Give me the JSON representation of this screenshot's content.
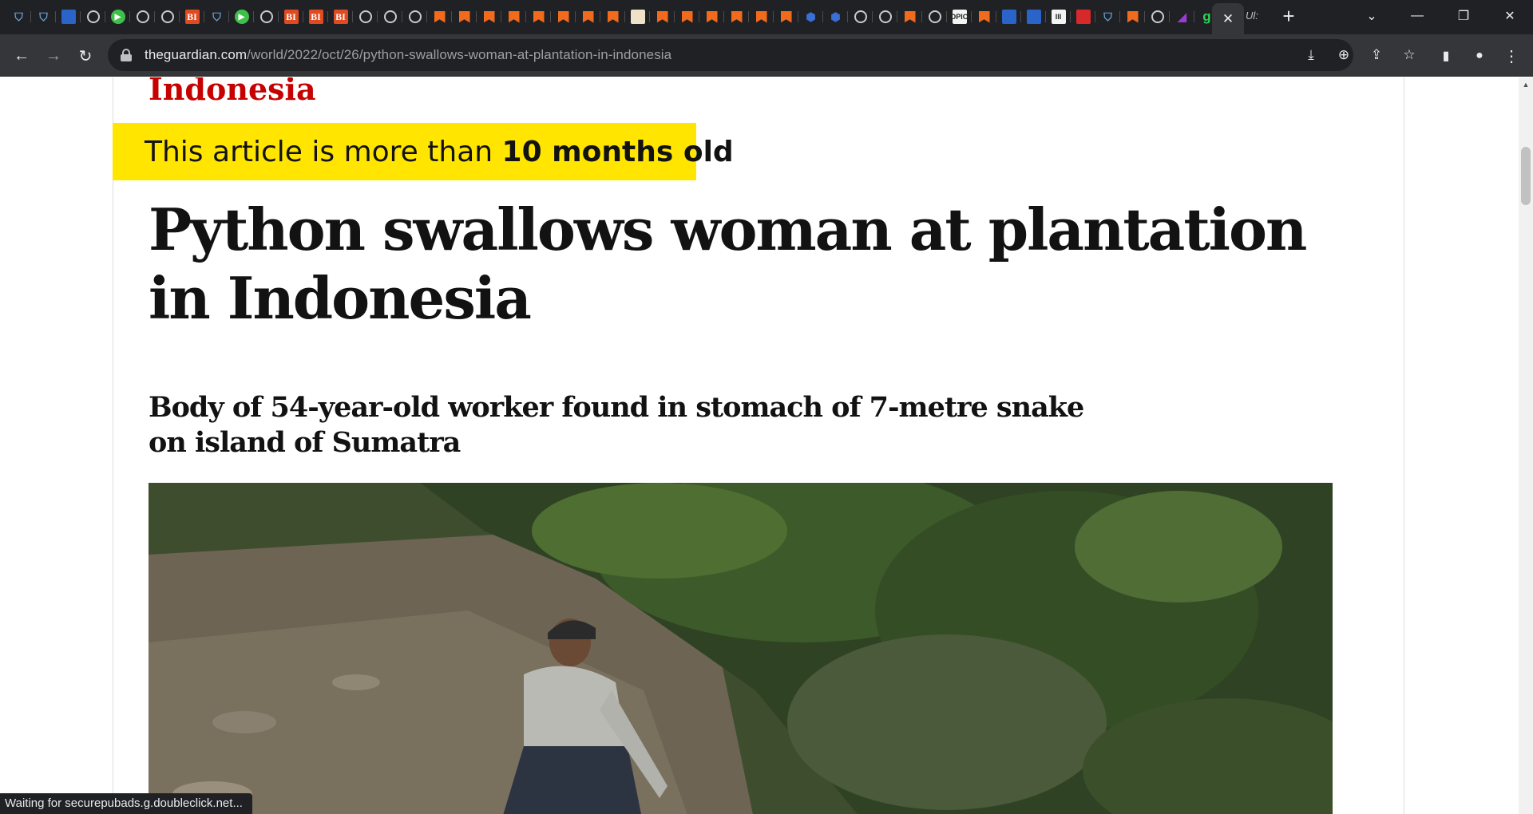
{
  "browser": {
    "tab_favicons": [
      {
        "kind": "shield",
        "glyph": "⛉"
      },
      {
        "kind": "shield",
        "glyph": "⛉"
      },
      {
        "kind": "blue",
        "glyph": ""
      },
      {
        "kind": "globe",
        "glyph": ""
      },
      {
        "kind": "play",
        "glyph": "▶"
      },
      {
        "kind": "globe",
        "glyph": ""
      },
      {
        "kind": "globe",
        "glyph": ""
      },
      {
        "kind": "bi",
        "glyph": "BI"
      },
      {
        "kind": "shield",
        "glyph": "⛉"
      },
      {
        "kind": "play",
        "glyph": "▶"
      },
      {
        "kind": "globe",
        "glyph": ""
      },
      {
        "kind": "bi",
        "glyph": "BI"
      },
      {
        "kind": "bi",
        "glyph": "BI"
      },
      {
        "kind": "bi",
        "glyph": "BI"
      },
      {
        "kind": "globe",
        "glyph": ""
      },
      {
        "kind": "globe",
        "glyph": ""
      },
      {
        "kind": "globe",
        "glyph": ""
      },
      {
        "kind": "bookmark",
        "glyph": ""
      },
      {
        "kind": "bookmark",
        "glyph": ""
      },
      {
        "kind": "bookmark",
        "glyph": ""
      },
      {
        "kind": "bookmark",
        "glyph": ""
      },
      {
        "kind": "bookmark",
        "glyph": ""
      },
      {
        "kind": "bookmark",
        "glyph": ""
      },
      {
        "kind": "bookmark",
        "glyph": ""
      },
      {
        "kind": "bookmark",
        "glyph": ""
      },
      {
        "kind": "doc",
        "glyph": ""
      },
      {
        "kind": "bookmark",
        "glyph": ""
      },
      {
        "kind": "bookmark",
        "glyph": ""
      },
      {
        "kind": "bookmark",
        "glyph": ""
      },
      {
        "kind": "bookmark",
        "glyph": ""
      },
      {
        "kind": "bookmark",
        "glyph": ""
      },
      {
        "kind": "bookmark",
        "glyph": ""
      },
      {
        "kind": "hex",
        "glyph": "⬢"
      },
      {
        "kind": "hex",
        "glyph": "⬢"
      },
      {
        "kind": "globe",
        "glyph": ""
      },
      {
        "kind": "globe",
        "glyph": ""
      },
      {
        "kind": "bookmark",
        "glyph": ""
      },
      {
        "kind": "globe",
        "glyph": ""
      },
      {
        "kind": "mono",
        "glyph": "DPIC"
      },
      {
        "kind": "bookmark",
        "glyph": ""
      },
      {
        "kind": "blue",
        "glyph": ""
      },
      {
        "kind": "blue",
        "glyph": ""
      },
      {
        "kind": "mono",
        "glyph": "III"
      },
      {
        "kind": "red",
        "glyph": ""
      },
      {
        "kind": "shield",
        "glyph": "⛉"
      },
      {
        "kind": "bookmark",
        "glyph": ""
      },
      {
        "kind": "globe",
        "glyph": ""
      },
      {
        "kind": "purple",
        "glyph": "◢"
      },
      {
        "kind": "g",
        "glyph": "g"
      }
    ],
    "active_tab_close": "✕",
    "extra_tab_glyph": "Ul:",
    "new_tab": "+",
    "window_controls": {
      "dropdown": "⌄",
      "minimize": "—",
      "restore": "❐",
      "close": "✕"
    },
    "nav": {
      "back": "←",
      "forward": "→",
      "reload": "↻"
    },
    "url_host": "theguardian.com",
    "url_path": "/world/2022/oct/26/python-swallows-woman-at-plantation-in-indonesia",
    "omnibox_icons": {
      "install": "⤓",
      "zoom": "⊕",
      "share": "⇪",
      "bookmark": "☆"
    },
    "toolbar_icons": {
      "side_panel": "▮",
      "profile": "●",
      "menu": "⋮"
    }
  },
  "article": {
    "section": "Indonesia",
    "age_warning_prefix": "This article is more than ",
    "age_warning_bold": "10 months old",
    "headline": "Python swallows woman at plantation in Indonesia",
    "standfirst": "Body of 54-year-old worker found in stomach of 7-metre snake on island of Sumatra"
  },
  "status_text": "Waiting for securepubads.g.doubleclick.net...",
  "colors": {
    "accent_red": "#c70000",
    "warning_yellow": "#ffe500",
    "chrome_dark": "#202124",
    "chrome_toolbar": "#35363a"
  }
}
